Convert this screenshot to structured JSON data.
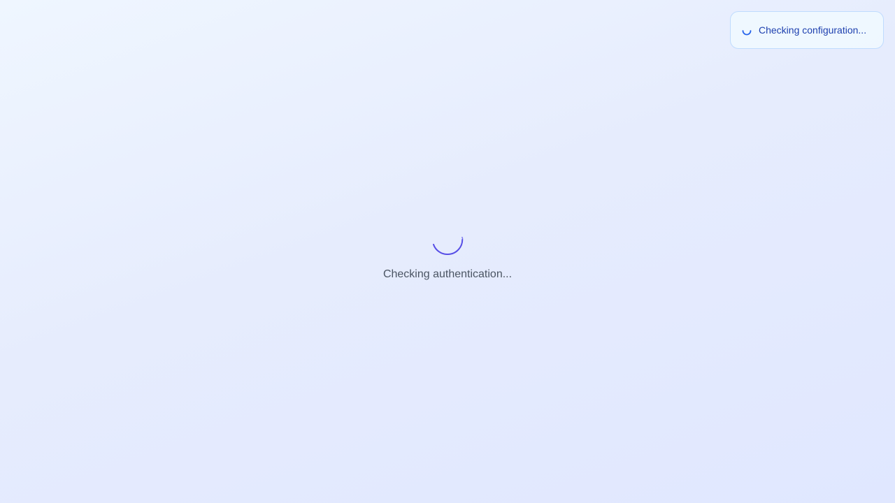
{
  "config_status": {
    "label": "Checking configuration...",
    "icon": "loading-spinner-icon"
  },
  "auth_status": {
    "label": "Checking authentication...",
    "icon": "loading-spinner-icon"
  },
  "colors": {
    "background_start": "#eff6ff",
    "background_end": "#e0e7ff",
    "spinner_accent": "#4f46e5",
    "toast_border": "#bfdbfe",
    "toast_text": "#1e40af",
    "auth_text": "#4b5563"
  }
}
